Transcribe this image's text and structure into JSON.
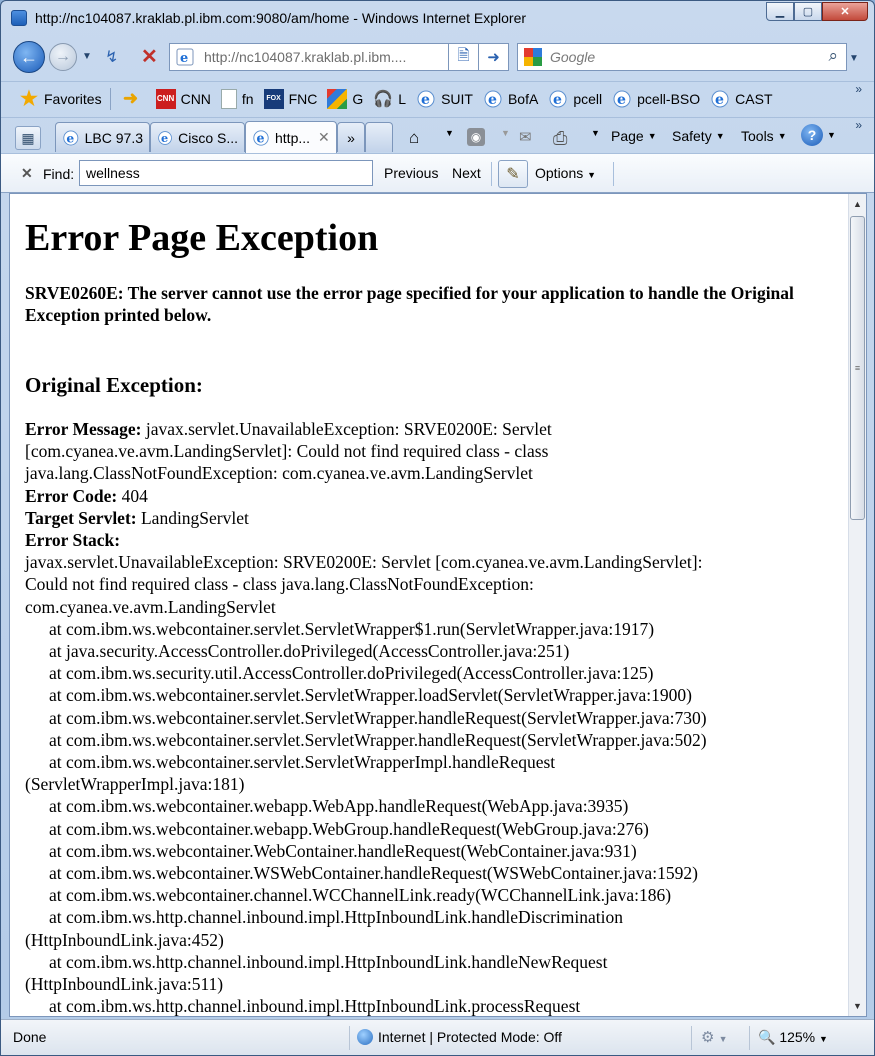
{
  "window": {
    "title": "http://nc104087.kraklab.pl.ibm.com:9080/am/home - Windows Internet Explorer",
    "min_icon": "minimize-icon",
    "max_icon": "maximize-icon",
    "close_icon": "close-icon"
  },
  "address_bar": {
    "url": "http://nc104087.kraklab.pl.ibm...."
  },
  "search_box": {
    "placeholder": "Google"
  },
  "favorites_bar": {
    "favorites_label": "Favorites",
    "items": [
      {
        "label": "CNN",
        "icon": "cnn-icon"
      },
      {
        "label": "fn",
        "icon": "page-icon"
      },
      {
        "label": "FNC",
        "icon": "fox-news-icon"
      },
      {
        "label": "G",
        "icon": "google-icon"
      },
      {
        "label": "L",
        "icon": "headphones-icon"
      },
      {
        "label": "SUIT",
        "icon": "ie-icon"
      },
      {
        "label": "BofA",
        "icon": "ie-icon"
      },
      {
        "label": "pcell",
        "icon": "ie-icon"
      },
      {
        "label": "pcell-BSO",
        "icon": "ie-icon"
      },
      {
        "label": "CAST",
        "icon": "ie-icon"
      }
    ]
  },
  "tabs": [
    {
      "label": "LBC 97.3",
      "active": false
    },
    {
      "label": "Cisco S...",
      "active": false
    },
    {
      "label": "http...",
      "active": true
    }
  ],
  "tabs_more": "»",
  "command_bar": {
    "page": "Page",
    "safety": "Safety",
    "tools": "Tools"
  },
  "find_bar": {
    "label": "Find:",
    "value": "wellness",
    "previous": "Previous",
    "next": "Next",
    "options": "Options"
  },
  "page": {
    "heading": "Error Page Exception",
    "subheading": "SRVE0260E: The server cannot use the error page specified for your application to handle the Original Exception printed below.",
    "original_exception_title": "Original Exception:",
    "error_message_label": "Error Message:",
    "error_message_lines": [
      " javax.servlet.UnavailableException: SRVE0200E: Servlet",
      "[com.cyanea.ve.avm.LandingServlet]: Could not find required class - class",
      "java.lang.ClassNotFoundException: com.cyanea.ve.avm.LandingServlet"
    ],
    "error_code_label": "Error Code:",
    "error_code": " 404",
    "target_servlet_label": "Target Servlet:",
    "target_servlet": " LandingServlet",
    "error_stack_label": "Error Stack:",
    "stack_lines": [
      {
        "text": "javax.servlet.UnavailableException: SRVE0200E: Servlet [com.cyanea.ve.avm.LandingServlet]:",
        "indent": false
      },
      {
        "text": "Could not find required class - class java.lang.ClassNotFoundException:",
        "indent": false
      },
      {
        "text": "com.cyanea.ve.avm.LandingServlet",
        "indent": false
      },
      {
        "text": "at com.ibm.ws.webcontainer.servlet.ServletWrapper$1.run(ServletWrapper.java:1917)",
        "indent": true
      },
      {
        "text": "at java.security.AccessController.doPrivileged(AccessController.java:251)",
        "indent": true
      },
      {
        "text": "at com.ibm.ws.security.util.AccessController.doPrivileged(AccessController.java:125)",
        "indent": true
      },
      {
        "text": "at com.ibm.ws.webcontainer.servlet.ServletWrapper.loadServlet(ServletWrapper.java:1900)",
        "indent": true
      },
      {
        "text": "at com.ibm.ws.webcontainer.servlet.ServletWrapper.handleRequest(ServletWrapper.java:730)",
        "indent": true
      },
      {
        "text": "at com.ibm.ws.webcontainer.servlet.ServletWrapper.handleRequest(ServletWrapper.java:502)",
        "indent": true
      },
      {
        "text": "at com.ibm.ws.webcontainer.servlet.ServletWrapperImpl.handleRequest",
        "indent": true
      },
      {
        "text": "(ServletWrapperImpl.java:181)",
        "indent": false
      },
      {
        "text": "at com.ibm.ws.webcontainer.webapp.WebApp.handleRequest(WebApp.java:3935)",
        "indent": true
      },
      {
        "text": "at com.ibm.ws.webcontainer.webapp.WebGroup.handleRequest(WebGroup.java:276)",
        "indent": true
      },
      {
        "text": "at com.ibm.ws.webcontainer.WebContainer.handleRequest(WebContainer.java:931)",
        "indent": true
      },
      {
        "text": "at com.ibm.ws.webcontainer.WSWebContainer.handleRequest(WSWebContainer.java:1592)",
        "indent": true
      },
      {
        "text": "at com.ibm.ws.webcontainer.channel.WCChannelLink.ready(WCChannelLink.java:186)",
        "indent": true
      },
      {
        "text": "at com.ibm.ws.http.channel.inbound.impl.HttpInboundLink.handleDiscrimination",
        "indent": true
      },
      {
        "text": "(HttpInboundLink.java:452)",
        "indent": false
      },
      {
        "text": "at com.ibm.ws.http.channel.inbound.impl.HttpInboundLink.handleNewRequest",
        "indent": true
      },
      {
        "text": "(HttpInboundLink.java:511)",
        "indent": false
      },
      {
        "text": "at com.ibm.ws.http.channel.inbound.impl.HttpInboundLink.processRequest",
        "indent": true
      }
    ]
  },
  "status_bar": {
    "status": "Done",
    "zone": "Internet | Protected Mode: Off",
    "zoom": "125%"
  }
}
